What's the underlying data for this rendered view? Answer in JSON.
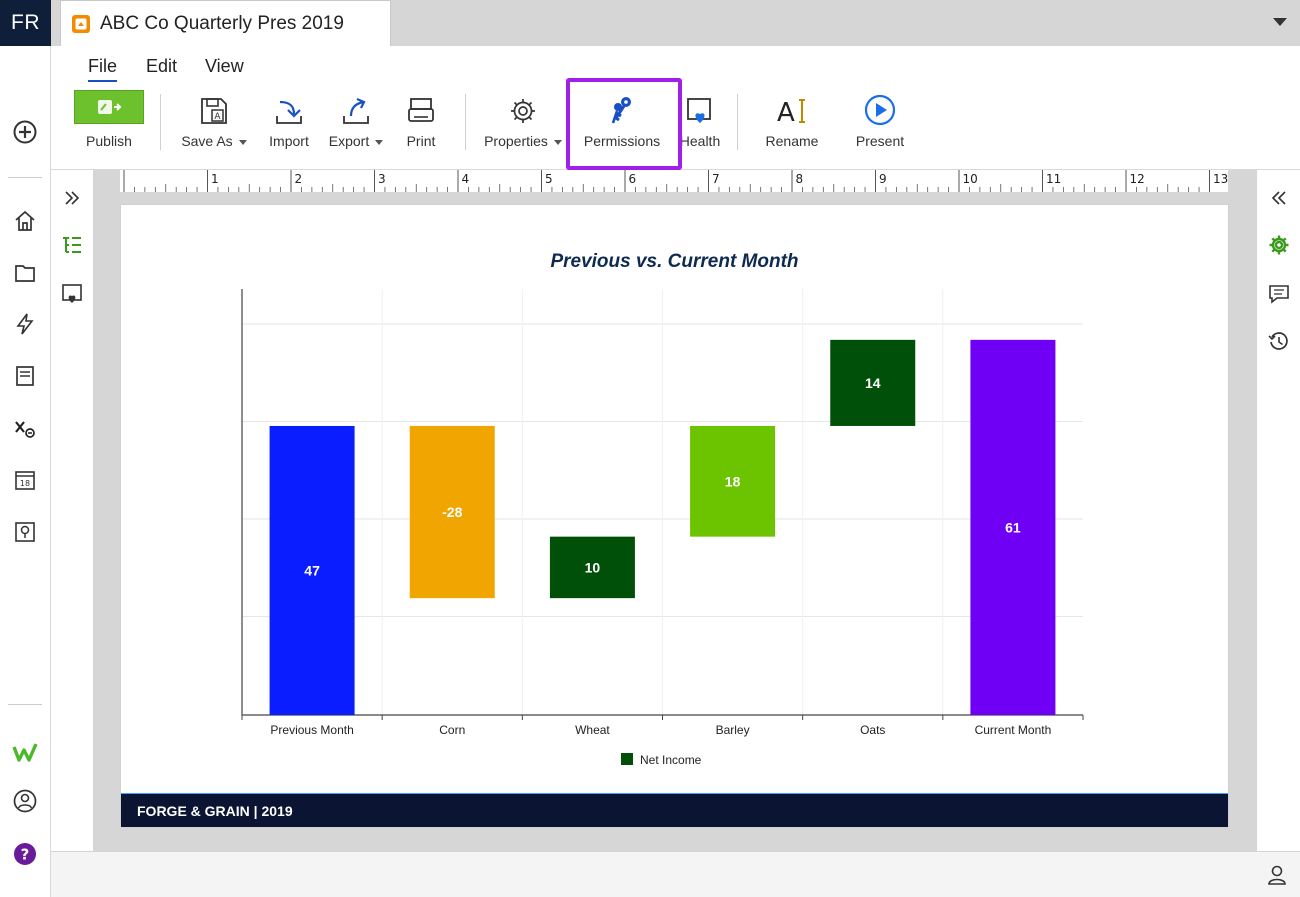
{
  "app": {
    "brand": "FR"
  },
  "tab": {
    "title": "ABC Co Quarterly Pres 2019"
  },
  "menu": {
    "items": [
      "File",
      "Edit",
      "View"
    ],
    "active": "File"
  },
  "toolbar": {
    "publish": "Publish",
    "save_as": "Save As",
    "import": "Import",
    "export": "Export",
    "print": "Print",
    "properties": "Properties",
    "permissions": "Permissions",
    "health": "Health",
    "rename": "Rename",
    "present": "Present"
  },
  "ruler": {
    "labels": [
      "1",
      "2",
      "3",
      "4",
      "5",
      "6",
      "7",
      "8",
      "9",
      "10",
      "11",
      "12",
      "13"
    ]
  },
  "slide": {
    "footer": "FORGE & GRAIN  |  2019"
  },
  "icons": {
    "rail": [
      "add-icon",
      "home-icon",
      "folder-icon",
      "lightning-icon",
      "document-icon",
      "variable-icon",
      "calendar-icon",
      "search-doc-icon",
      "wdesk-logo-icon",
      "profile-icon",
      "help-icon"
    ],
    "left_panel": [
      "expand-icon",
      "outline-icon",
      "health-panel-icon"
    ],
    "right_panel": [
      "collapse-icon",
      "settings-icon",
      "comments-icon",
      "history-icon"
    ]
  },
  "colors": {
    "accent_green": "#6cc12c",
    "highlight_purple": "#a020e8",
    "footer_navy": "#0b1433",
    "title_navy": "#0e2a50"
  },
  "chart_data": {
    "type": "bar",
    "subtype": "waterfall",
    "title": "Previous vs. Current Month",
    "categories": [
      "Previous Month",
      "Corn",
      "Wheat",
      "Barley",
      "Oats",
      "Current Month"
    ],
    "values": [
      47,
      -28,
      10,
      18,
      14,
      61
    ],
    "labels": [
      "47",
      "-28",
      "10",
      "18",
      "14",
      "61"
    ],
    "colors": [
      "#0a1dff",
      "#f0a500",
      "#00500a",
      "#6cc300",
      "#00500a",
      "#7000f5"
    ],
    "legend": [
      "Net Income"
    ],
    "legend_color": "#00500a",
    "legend_position": "bottom",
    "ylim": [
      0,
      66
    ],
    "grid": true
  }
}
